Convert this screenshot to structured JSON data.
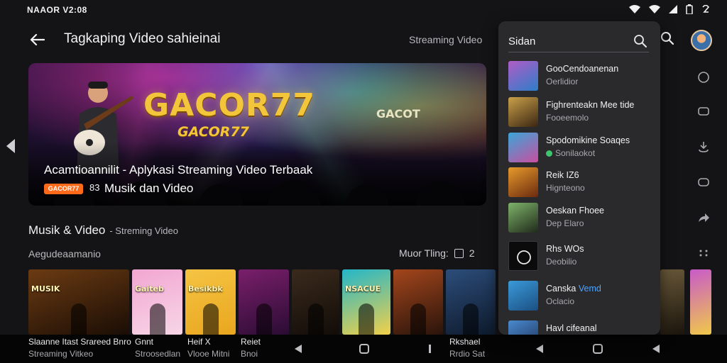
{
  "status_bar": {
    "time": "NAAOR V2:08"
  },
  "app_bar": {
    "title": "Tagkaping Video sahieinai",
    "subtitle": "Streaming Video"
  },
  "hero": {
    "brand": "GACOR77",
    "brand_small": "GACOR77",
    "stage_logo": "GACOT",
    "headline": "Acamtioannilit - Aplykasi Streaming Video Terbaak",
    "badge": "GACOR77",
    "badge_sep": "83",
    "subline": "Musik dan Video"
  },
  "section": {
    "title": "Musik & Video",
    "title_suffix": "- Streming Video",
    "row_label": "Aegudeaamanio",
    "more_label": "Muor Tling:",
    "more_count": "2"
  },
  "tiles": [
    {
      "caption": "MUSIK",
      "colors": [
        "#6b3b12",
        "#1a0d05"
      ]
    },
    {
      "caption": "Gaiteb",
      "colors": [
        "#f2a6d2",
        "#f7d6e6"
      ]
    },
    {
      "caption": "Besikbk",
      "colors": [
        "#f5c443",
        "#e9a61f"
      ]
    },
    {
      "caption": "",
      "colors": [
        "#7a1f6b",
        "#2a0c33"
      ]
    },
    {
      "caption": "",
      "colors": [
        "#3a2a1c",
        "#120c08"
      ]
    },
    {
      "caption": "NSACUE",
      "colors": [
        "#23b6c9",
        "#f2d04a"
      ]
    },
    {
      "caption": "",
      "colors": [
        "#a3461c",
        "#2a140b"
      ]
    },
    {
      "caption": "",
      "colors": [
        "#2c4d7a",
        "#0e1a2c"
      ]
    }
  ],
  "tile_captions": [
    {
      "line1": "Slaanne Itast Srareed Bnro",
      "line2": "Streaming Vitkeo"
    },
    {
      "line1": "Gnnt",
      "line2": "Stroosedlan"
    },
    {
      "line1": "Heif X",
      "line2": "Vlooe Mitni"
    },
    {
      "line1": "Reiet",
      "line2": "Bnoi"
    },
    {
      "line1": "Rkshael",
      "line2": "Rrdio Sat"
    }
  ],
  "dropdown": {
    "search_value": "Sidan",
    "results": [
      {
        "title": "GooCendoanenan",
        "sub": "Oerlidior",
        "verified": false,
        "highlight": "",
        "colors": [
          "#b05cc6",
          "#2d7ec9"
        ]
      },
      {
        "title": "Fighrenteakn Mee tide",
        "sub": "Fooeemolo",
        "verified": false,
        "highlight": "",
        "colors": [
          "#c9a04a",
          "#3b2612"
        ]
      },
      {
        "title": "Spodomikine Soaqes",
        "sub": "Sonilaokot",
        "verified": true,
        "highlight": "",
        "colors": [
          "#3aa6d8",
          "#c94fa0"
        ]
      },
      {
        "title": "Reik IZ6",
        "sub": "Hignteono",
        "verified": false,
        "highlight": "",
        "colors": [
          "#e79a2c",
          "#6b2a0e"
        ]
      },
      {
        "title": "Oeskan Fhoee",
        "sub": "Dep Elaro",
        "verified": false,
        "highlight": "",
        "colors": [
          "#7fb36a",
          "#1f2a1a"
        ]
      },
      {
        "title": "Rhs WOs",
        "sub": "Deobilio",
        "verified": false,
        "highlight": "",
        "colors": [
          "#0b0b0c",
          "#0b0b0c"
        ]
      },
      {
        "title": "Canska ",
        "sub": "Oclacio",
        "verified": false,
        "highlight": "Vemd",
        "colors": [
          "#3a9ad9",
          "#1b4f82"
        ]
      },
      {
        "title": "Havl cifeanal",
        "sub": "",
        "verified": false,
        "highlight": "",
        "colors": [
          "#4a8ad0",
          "#1d2f55"
        ]
      }
    ]
  },
  "side_tiles": [
    {
      "colors": [
        "#6b5a3a",
        "#1a140c"
      ]
    },
    {
      "colors": [
        "#c85ac9",
        "#f0c94a"
      ]
    }
  ]
}
